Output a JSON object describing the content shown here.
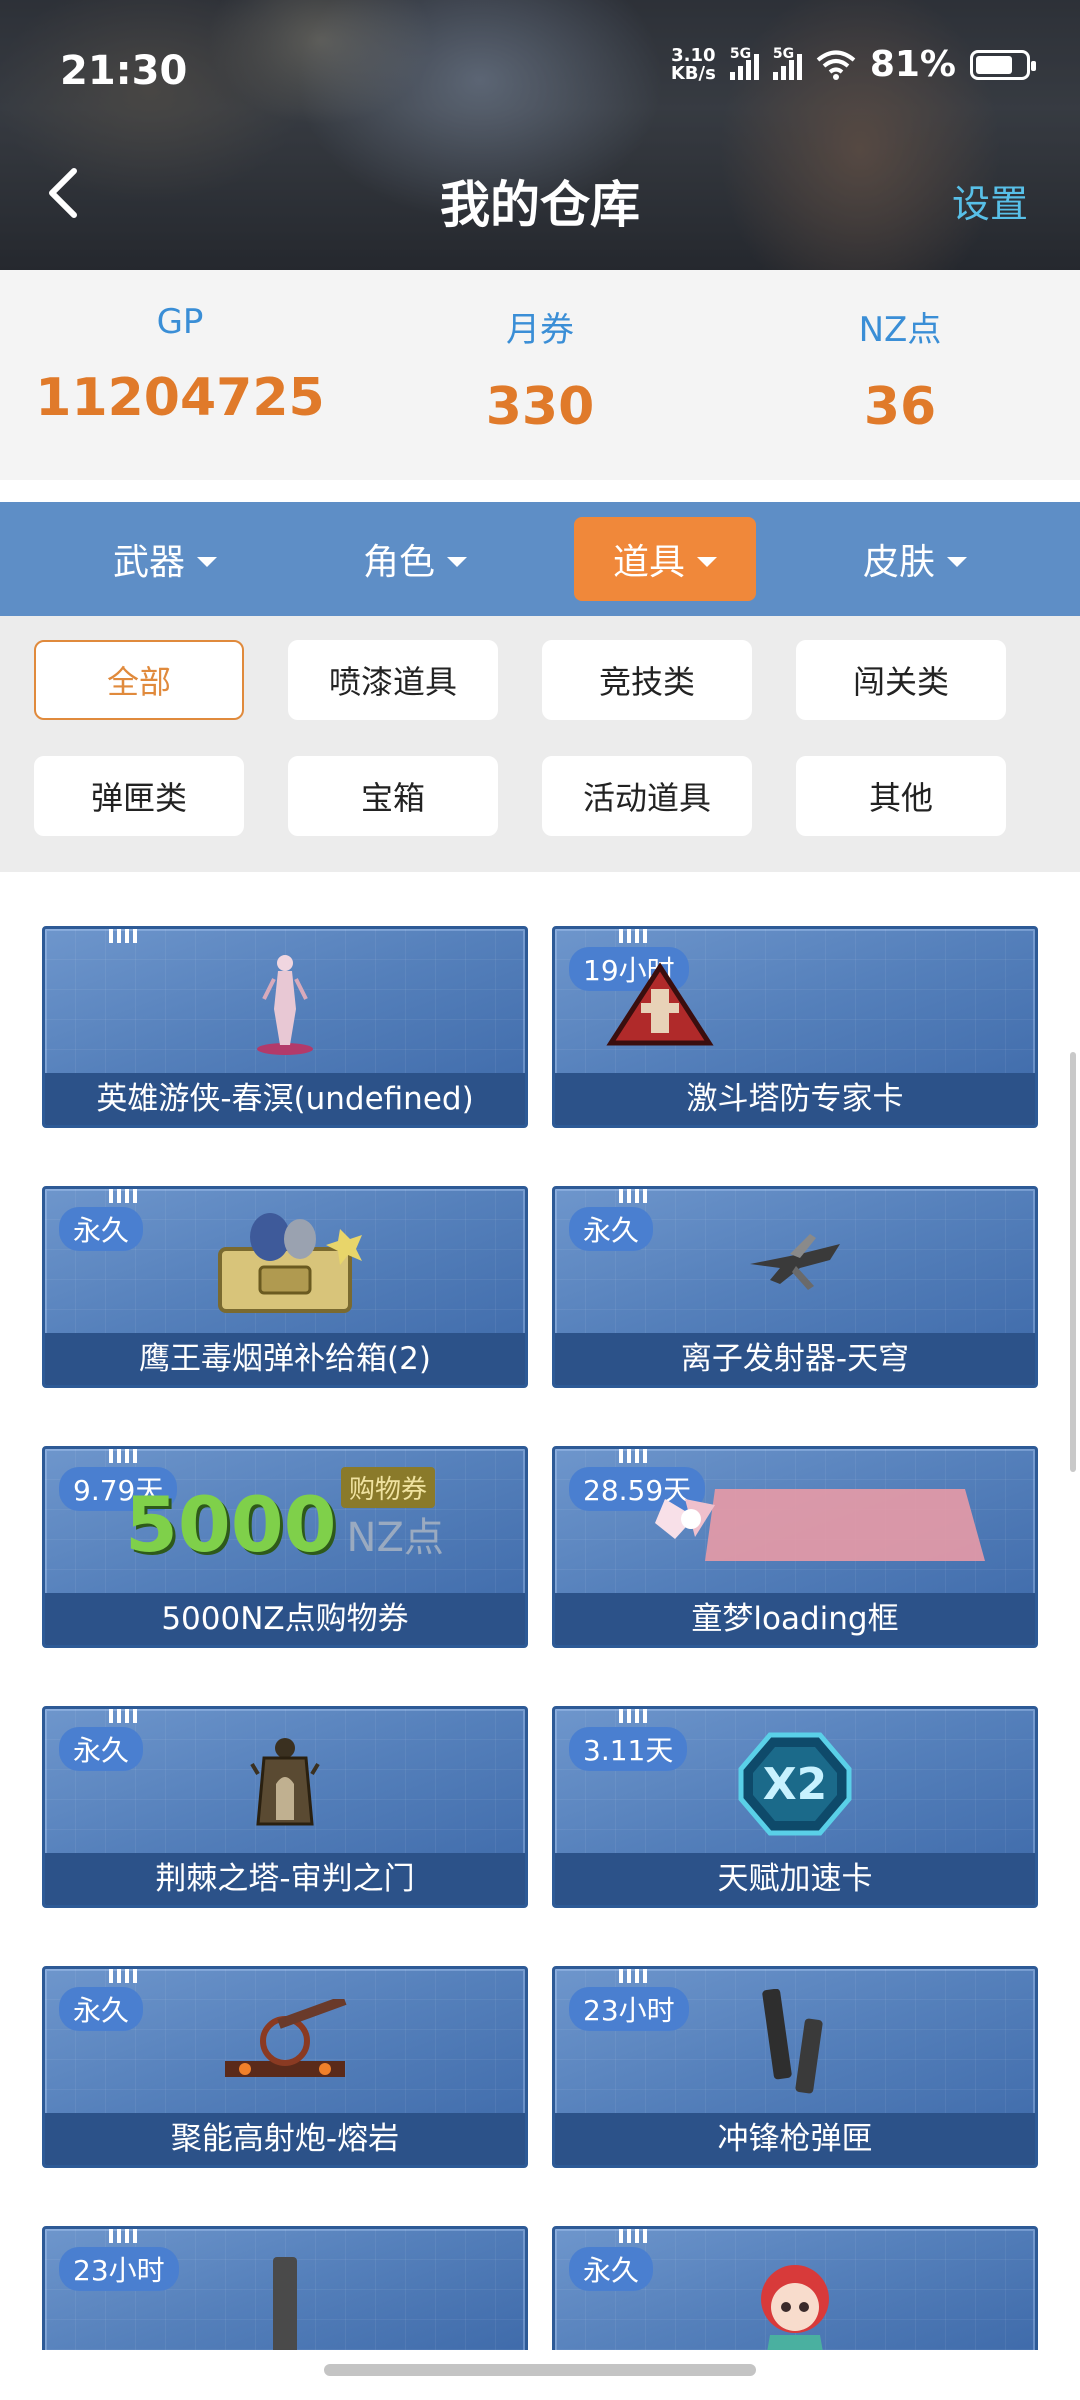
{
  "status": {
    "time": "21:30",
    "net_speed_value": "3.10",
    "net_speed_unit": "KB/s",
    "signal1_tag": "5G",
    "signal2_tag": "5G",
    "battery": "81%"
  },
  "nav": {
    "title": "我的仓库",
    "settings": "设置"
  },
  "currency": [
    {
      "label": "GP",
      "value": "11204725"
    },
    {
      "label": "月券",
      "value": "330"
    },
    {
      "label": "NZ点",
      "value": "36"
    }
  ],
  "tabs": [
    {
      "label": "武器",
      "active": false
    },
    {
      "label": "角色",
      "active": false
    },
    {
      "label": "道具",
      "active": true
    },
    {
      "label": "皮肤",
      "active": false
    }
  ],
  "filters": [
    {
      "label": "全部",
      "active": true
    },
    {
      "label": "喷漆道具"
    },
    {
      "label": "竞技类"
    },
    {
      "label": "闯关类"
    },
    {
      "label": "弹匣类"
    },
    {
      "label": "宝箱"
    },
    {
      "label": "活动道具"
    },
    {
      "label": "其他"
    }
  ],
  "items": [
    {
      "name": "英雄游侠-春溟(undefined)",
      "badge": "",
      "icon": "character-figure-icon"
    },
    {
      "name": "激斗塔防专家卡",
      "badge": "19小时",
      "icon": "tower-defense-emblem-icon"
    },
    {
      "name": "鹰王毒烟弹补给箱(2)",
      "badge": "永久",
      "icon": "supply-box-icon"
    },
    {
      "name": "离子发射器-天穹",
      "badge": "永久",
      "icon": "ion-launcher-icon"
    },
    {
      "name": "5000NZ点购物券",
      "badge": "9.79天",
      "icon": "voucher-icon",
      "voucher_amount": "5000",
      "voucher_unit": "NZ点",
      "voucher_tag": "购物券"
    },
    {
      "name": "童梦loading框",
      "badge": "28.59天",
      "icon": "loading-frame-icon"
    },
    {
      "name": "荆棘之塔-审判之门",
      "badge": "永久",
      "icon": "tower-gate-icon"
    },
    {
      "name": "天赋加速卡",
      "badge": "3.11天",
      "icon": "speed-card-icon",
      "speed_text": "X2"
    },
    {
      "name": "聚能高射炮-熔岩",
      "badge": "永久",
      "icon": "cannon-icon"
    },
    {
      "name": "冲锋枪弹匣",
      "badge": "23小时",
      "icon": "magazine-icon"
    },
    {
      "name": "",
      "badge": "23小时",
      "icon": "magazine-single-icon"
    },
    {
      "name": "",
      "badge": "永久",
      "icon": "chibi-character-icon"
    }
  ]
}
